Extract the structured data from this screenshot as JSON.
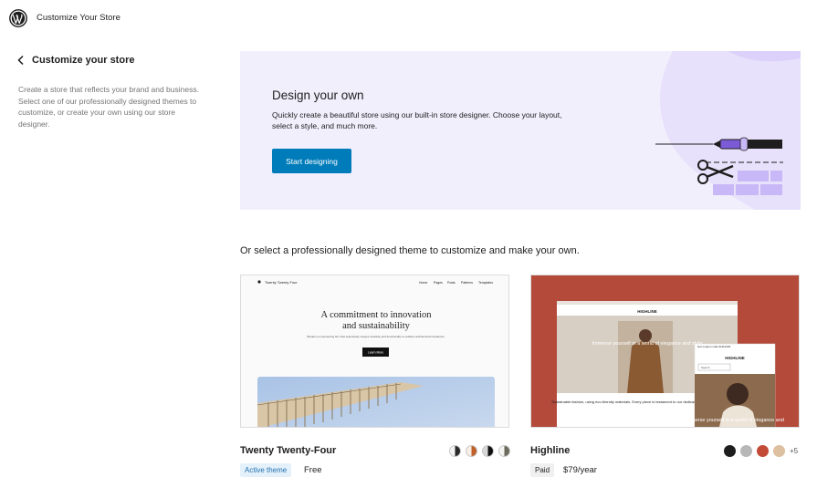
{
  "header": {
    "app_title": "Customize Your Store"
  },
  "sidebar": {
    "back_title": "Customize your store",
    "description": "Create a store that reflects your brand and business. Select one of our professionally designed themes to customize, or create your own using our store designer."
  },
  "hero": {
    "title": "Design your own",
    "description": "Quickly create a beautiful store using our built-in store designer. Choose your layout, select a style, and much more.",
    "button_label": "Start designing"
  },
  "themes_heading": "Or select a professionally designed theme to customize and make your own.",
  "themes": [
    {
      "name": "Twenty Twenty-Four",
      "badge": "Active theme",
      "price": "Free",
      "preview": {
        "site_title": "Twenty Twenty Four",
        "nav": [
          "Home",
          "Pages",
          "Posts",
          "Patterns",
          "Templates"
        ],
        "headline_1": "A commitment to innovation",
        "headline_2": "and sustainability",
        "body": "Études is a pioneering firm that seamlessly merges creativity and functionality to redefine architectural excellence.",
        "cta": "Learn More"
      },
      "swatches": [
        {
          "left": "#2a2a2a",
          "right": "#f4f4f4"
        },
        {
          "left": "#c0612b",
          "right": "#f7efe6"
        },
        {
          "left": "#111111",
          "right": "#d8d8d8"
        },
        {
          "left": "#6b6b5e",
          "right": "#f4f4f0"
        }
      ]
    },
    {
      "name": "Highline",
      "badge": "Paid",
      "price": "$79/year",
      "preview": {
        "brand": "HIGHLINE",
        "hero_text_1": "Immerse yourself in a world of elegance and style",
        "hero_text_2": "Immerse yourself in a world of elegance and",
        "caption": "Sustainable fashion, using eco-friendly materials. Every piece is testament to our dedication.",
        "promo": "Get coupon code 6NA1234",
        "search_placeholder": "Search"
      },
      "swatches": [
        "#1e1e1e",
        "#b7b7b7",
        "#c24a36",
        "#dcc0a0"
      ],
      "more_swatches": "+5"
    }
  ]
}
